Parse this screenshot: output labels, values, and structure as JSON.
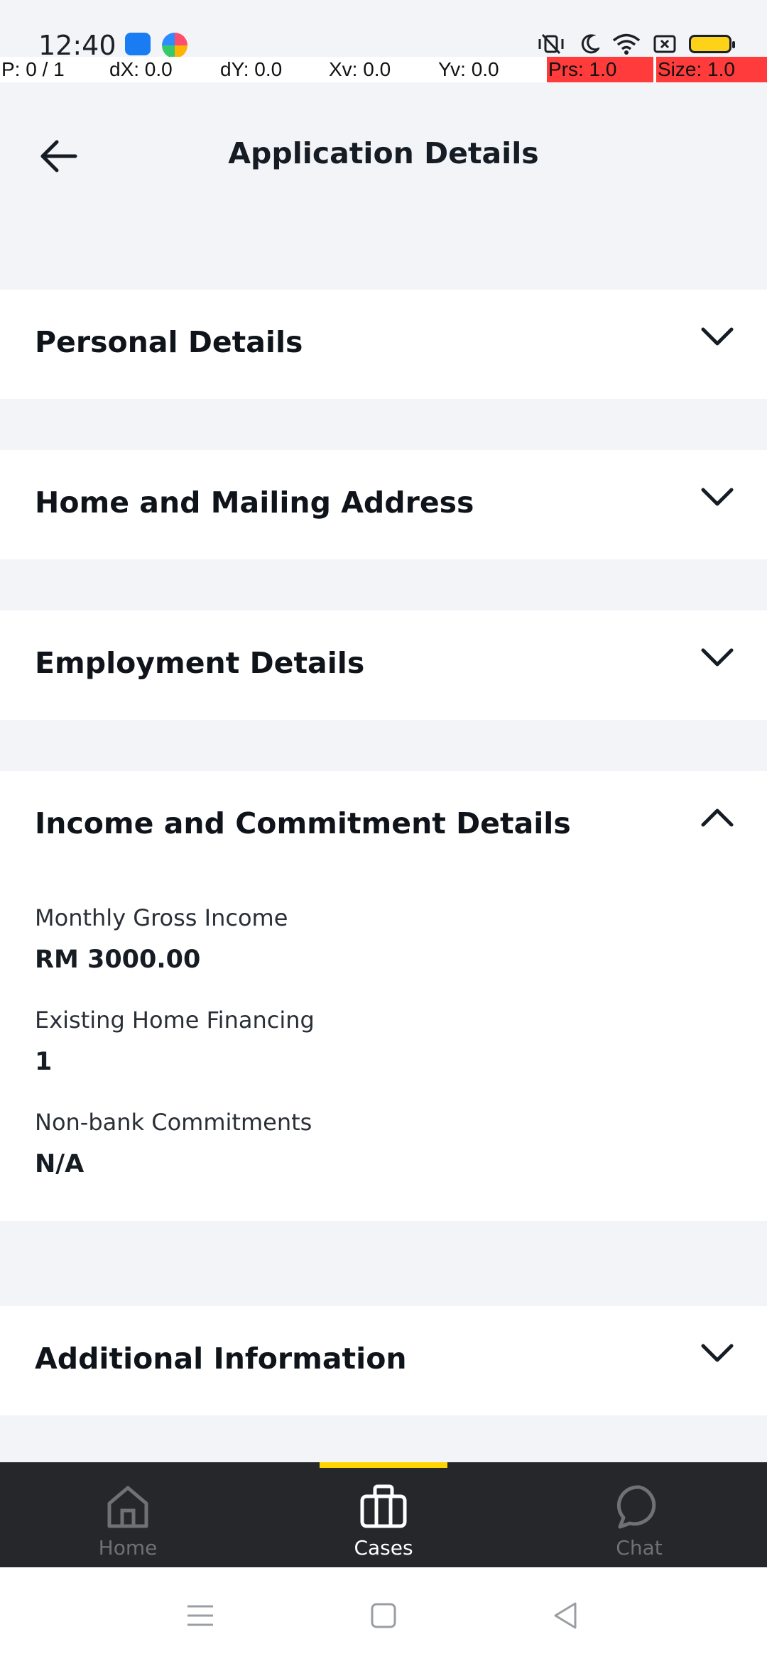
{
  "status_bar": {
    "time": "12:40",
    "icons": [
      "android-debug-icon",
      "app-color-icon",
      "vibrate-off-icon",
      "moon-icon",
      "wifi-icon",
      "screen-record-icon",
      "battery-icon"
    ]
  },
  "pointer_overlay": {
    "p": "P: 0 / 1",
    "dx": "dX: 0.0",
    "dy": "dY: 0.0",
    "xv": "Xv: 0.0",
    "yv": "Yv: 0.0",
    "prs": "Prs: 1.0",
    "size": "Size: 1.0"
  },
  "header": {
    "title": "Application Details"
  },
  "sections": [
    {
      "title": "Personal Details",
      "expanded": false
    },
    {
      "title": "Home and Mailing Address",
      "expanded": false
    },
    {
      "title": "Employment Details",
      "expanded": false
    },
    {
      "title": "Income and Commitment Details",
      "expanded": true,
      "fields": [
        {
          "label": "Monthly Gross Income",
          "value": "RM 3000.00"
        },
        {
          "label": "Existing Home Financing",
          "value": "1"
        },
        {
          "label": "Non-bank Commitments",
          "value": "N/A"
        }
      ]
    },
    {
      "title": "Additional Information",
      "expanded": false
    }
  ],
  "bottom_nav": {
    "items": [
      {
        "label": "Home",
        "icon": "home-icon",
        "active": false
      },
      {
        "label": "Cases",
        "icon": "briefcase-icon",
        "active": true
      },
      {
        "label": "Chat",
        "icon": "chat-bubble-icon",
        "active": false
      }
    ]
  },
  "colors": {
    "accent": "#ffd400",
    "nav_background": "#25272b",
    "page_background": "#f3f4f8",
    "overlay_highlight": "#ff3b3b"
  }
}
